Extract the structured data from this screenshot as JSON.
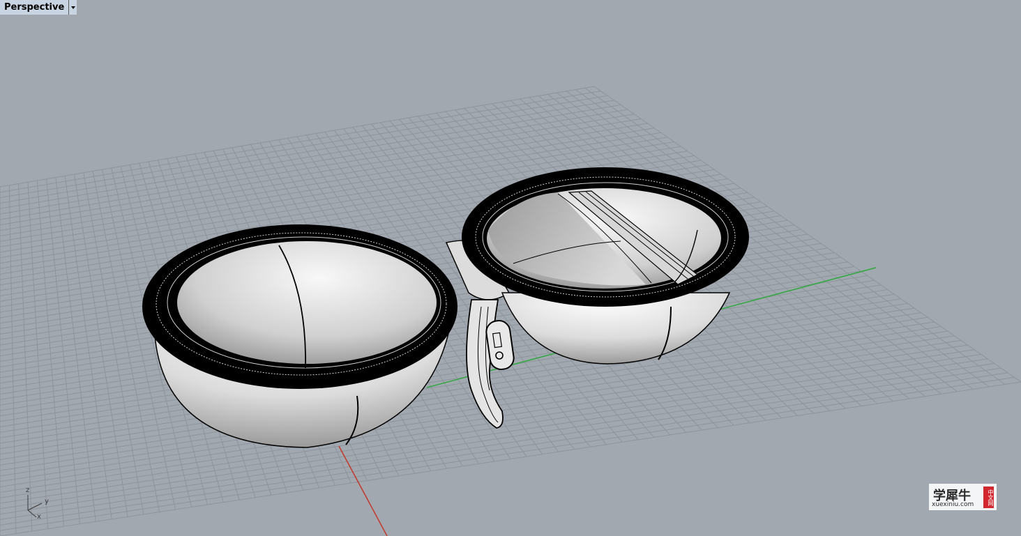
{
  "viewport": {
    "title": "Perspective",
    "dropdown_icon": "chevron-down-icon",
    "background_color": "#a2a8b0",
    "grid_color": "#8c9198",
    "x_axis_color": "#c0392b",
    "y_axis_color": "#27a83a"
  },
  "axis_widget": {
    "z": "z",
    "y": "y",
    "x": "x"
  },
  "watermark": {
    "main_text": "学犀牛",
    "url_text": "xuexiniu.com",
    "seal_text": "中文网"
  }
}
